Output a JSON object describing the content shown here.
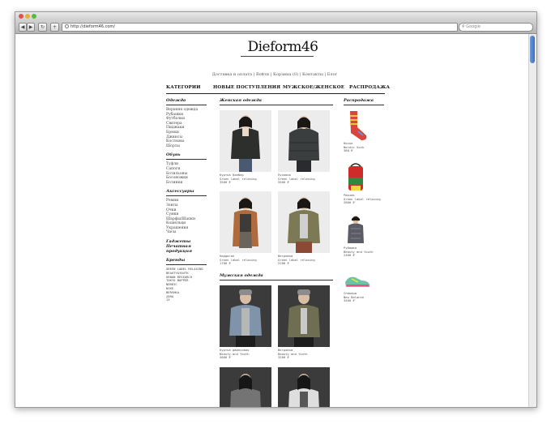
{
  "browser": {
    "url": "http://dieform46.com/",
    "search_placeholder": "Google",
    "search_icon": "magnifier-icon"
  },
  "site": {
    "logo": "Dieform46",
    "top_links": [
      "Доставка и оплата",
      "Войти",
      "Корзина (0)",
      "Контакты",
      "Блог"
    ],
    "main_nav": [
      "КАТЕГОРИИ",
      "НОВЫЕ ПОСТУПЛЕНИЯ",
      "МУЖСКОЕ/ЖЕНСКОЕ",
      "РАСПРОДАЖА"
    ]
  },
  "sidebar": {
    "clothes_title": "Одежда",
    "clothes": [
      "Верхняя одежда",
      "Рубашки",
      "Футболки",
      "Свитера",
      "Пиджаки",
      "Брюки",
      "Джинсы",
      "Костюмы",
      "Шорты"
    ],
    "shoes_title": "Обувь",
    "shoes": [
      "Туфли",
      "Сапоги",
      "Ботильоны",
      "Босоножки",
      "Ботинки"
    ],
    "accessories_title": "Аксессуары",
    "accessories": [
      "Ремни",
      "Зонты",
      "Очки",
      "Сумки",
      "Шарфы/Шапки",
      "Кошельки",
      "Украшения",
      "Часы"
    ],
    "special_1": "Гаджеты",
    "special_2": "Печатная продукция",
    "brands_title": "Бренды",
    "brands": [
      "GREEN LABEL RELAXING",
      "BEAUTY&YOUTH",
      "URBAN RESEARCH",
      "TOKYO BOPPER",
      "NORDIC",
      "NIKE",
      "BERSHKA",
      "ZARA",
      "13"
    ]
  },
  "women": {
    "title": "Женская одежда",
    "products": [
      {
        "name": "Куртка бомбер",
        "brand": "Green label relaxing",
        "price": "3500 ₽"
      },
      {
        "name": "Пуховик",
        "brand": "Green label relaxing",
        "price": "5500 ₽"
      },
      {
        "name": "Кардиган",
        "brand": "Green label relaxing",
        "price": "1700 ₽"
      },
      {
        "name": "Ветровка",
        "brand": "Green label relaxing",
        "price": "2200 ₽"
      }
    ]
  },
  "men": {
    "title": "Мужская одежда",
    "products": [
      {
        "name": "Куртка джинсовая",
        "brand": "Beauty and Youth",
        "price": "4000 ₽"
      },
      {
        "name": "Ветровка",
        "brand": "Beauty and Youth",
        "price": "3200 ₽"
      },
      {
        "name": "",
        "brand": "",
        "price": ""
      },
      {
        "name": "",
        "brand": "",
        "price": ""
      }
    ]
  },
  "sale": {
    "title": "Распродажа",
    "products": [
      {
        "name": "Носки",
        "brand": "Nordic Sock",
        "price": "380 ₽"
      },
      {
        "name": "Рюкзак",
        "brand": "Green label relaxing",
        "price": "2800 ₽"
      },
      {
        "name": "Рубашка",
        "brand": "Beauty and Youth",
        "price": "2400 ₽"
      },
      {
        "name": "Сникеры",
        "brand": "New Balance",
        "price": "3400 ₽"
      }
    ]
  }
}
